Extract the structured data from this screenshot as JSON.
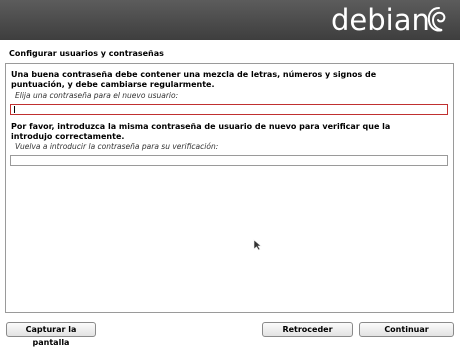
{
  "banner": {
    "logo_text": "debian",
    "logo_icon": "debian-swirl-icon"
  },
  "page": {
    "title": "Configurar usuarios y contraseñas"
  },
  "form": {
    "intro": "Una buena contraseña debe contener una mezcla de letras, números y signos de puntuación, y debe cambiarse regularmente.",
    "password_label": "Elija una contraseña para el nuevo usuario:",
    "password_value": "",
    "verify_intro": "Por favor, introduzca la misma contraseña de usuario de nuevo para verificar que la introdujo correctamente.",
    "verify_label": "Vuelva a introducir la contraseña para su verificación:",
    "verify_value": ""
  },
  "buttons": {
    "screenshot": "Capturar la pantalla",
    "back": "Retroceder",
    "continue": "Continuar"
  },
  "colors": {
    "banner": "#4d4d4d",
    "active_field_border": "#c03030"
  }
}
